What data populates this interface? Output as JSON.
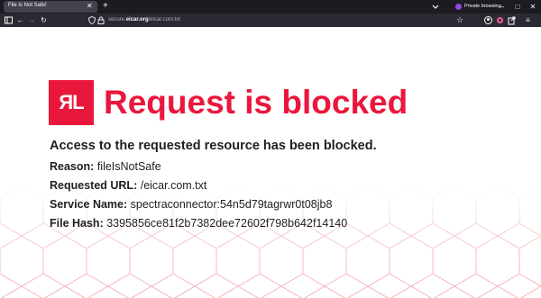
{
  "browser": {
    "tab_title": "File Is Not Safe!",
    "private_label": "Private browsing",
    "url_prefix": "secure.",
    "url_domain": "eicar.org",
    "url_path": "/eicar.com.txt"
  },
  "page": {
    "logo_text": "ЯL",
    "heading": "Request is blocked",
    "lead": "Access to the requested resource has been blocked.",
    "fields": [
      {
        "label": "Reason:",
        "value": "fileIsNotSafe"
      },
      {
        "label": "Requested URL:",
        "value": "/eicar.com.txt"
      },
      {
        "label": "Service Name:",
        "value": "spectraconnector:54n5d79tagrwr0t08jb8"
      },
      {
        "label": "File Hash:",
        "value": "3395856ce81f2b7382dee72602f798b642f14140"
      }
    ]
  },
  "colors": {
    "accent": "#ea173c",
    "text": "#1f1f1f",
    "chrome_dark": "#1c1b22",
    "toolbar": "#2b2a33"
  }
}
